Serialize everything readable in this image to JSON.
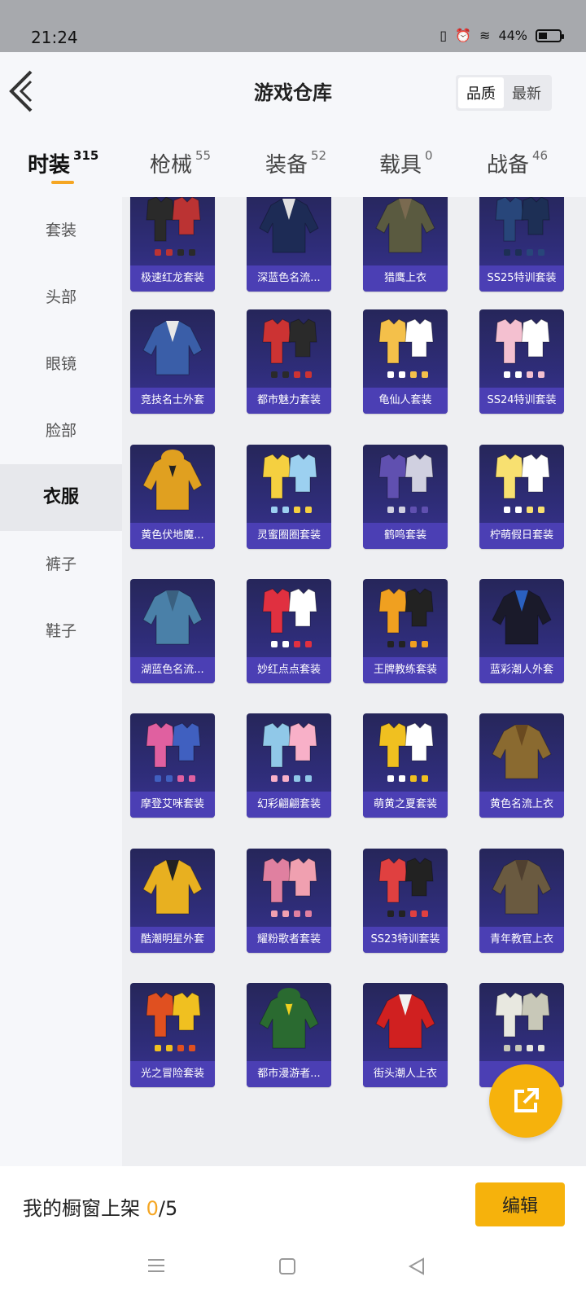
{
  "status": {
    "time": "21:24",
    "battery": "44%"
  },
  "header": {
    "title": "游戏仓库",
    "sort": [
      "品质",
      "最新"
    ]
  },
  "tabs": [
    {
      "label": "时装",
      "count": "315"
    },
    {
      "label": "枪械",
      "count": "55"
    },
    {
      "label": "装备",
      "count": "52"
    },
    {
      "label": "载具",
      "count": "0"
    },
    {
      "label": "战备",
      "count": "46"
    }
  ],
  "sidebar": [
    "套装",
    "头部",
    "眼镜",
    "脸部",
    "衣服",
    "裤子",
    "鞋子"
  ],
  "items": [
    {
      "name": "极速红龙套装",
      "icon": "suit-icon"
    },
    {
      "name": "深蓝色名流...",
      "icon": "jacket-icon"
    },
    {
      "name": "猎鹰上衣",
      "icon": "jacket-icon"
    },
    {
      "name": "SS25特训套装",
      "icon": "suit-icon"
    },
    {
      "name": "竞技名士外套",
      "icon": "jacket-icon"
    },
    {
      "name": "都市魅力套装",
      "icon": "suit-icon"
    },
    {
      "name": "龟仙人套装",
      "icon": "suit-icon"
    },
    {
      "name": "SS24特训套装",
      "icon": "suit-icon"
    },
    {
      "name": "黄色伏地魔...",
      "icon": "hoodie-icon"
    },
    {
      "name": "灵蜜圈圈套装",
      "icon": "suit-icon"
    },
    {
      "name": "鹤鸣套装",
      "icon": "suit-icon"
    },
    {
      "name": "柠萌假日套装",
      "icon": "suit-icon"
    },
    {
      "name": "湖蓝色名流...",
      "icon": "jacket-icon"
    },
    {
      "name": "妙红点点套装",
      "icon": "suit-icon"
    },
    {
      "name": "王牌教练套装",
      "icon": "suit-icon"
    },
    {
      "name": "蓝彩潮人外套",
      "icon": "jacket-icon"
    },
    {
      "name": "摩登艾咪套装",
      "icon": "suit-icon"
    },
    {
      "name": "幻彩翩翩套装",
      "icon": "suit-icon"
    },
    {
      "name": "萌黄之夏套装",
      "icon": "suit-icon"
    },
    {
      "name": "黄色名流上衣",
      "icon": "jacket-icon"
    },
    {
      "name": "酷潮明星外套",
      "icon": "jacket-icon"
    },
    {
      "name": "耀粉歌者套装",
      "icon": "suit-icon"
    },
    {
      "name": "SS23特训套装",
      "icon": "suit-icon"
    },
    {
      "name": "青年教官上衣",
      "icon": "jacket-icon"
    },
    {
      "name": "光之冒险套装",
      "icon": "suit-icon"
    },
    {
      "name": "都市漫游者...",
      "icon": "hoodie-icon"
    },
    {
      "name": "街头潮人上衣",
      "icon": "jacket-icon"
    },
    {
      "name": "",
      "icon": "suit-icon"
    }
  ],
  "bottom": {
    "showcase_label": "我的橱窗上架",
    "showcase_current": "0",
    "showcase_total": "/5",
    "edit": "编辑"
  },
  "colors": {
    "accent": "#f6b20c",
    "card_label": "#4b3fb4",
    "card_bg": "#2f2d7a"
  }
}
